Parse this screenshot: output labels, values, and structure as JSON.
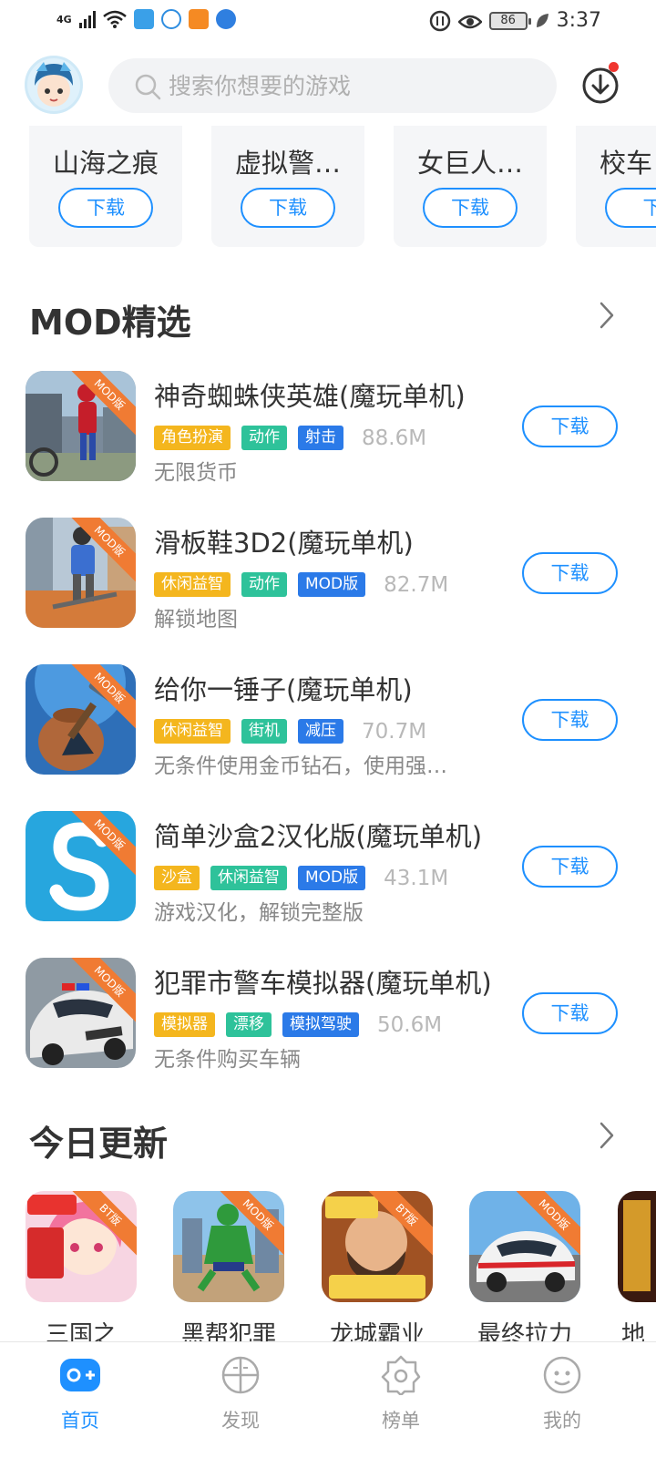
{
  "status_bar": {
    "network": "4G",
    "battery": "86",
    "time": "3:37"
  },
  "search": {
    "placeholder": "搜索你想要的游戏"
  },
  "top_cards": [
    {
      "name": "山海之痕",
      "button": "下载"
    },
    {
      "name": "虚拟警…",
      "button": "下载"
    },
    {
      "name": "女巨人…",
      "button": "下载"
    },
    {
      "name": "校车",
      "button": "下"
    }
  ],
  "mod_section": {
    "title": "MOD精选",
    "items": [
      {
        "name": "神奇蜘蛛侠英雄(魔玩单机)",
        "tags": [
          "角色扮演",
          "动作",
          "射击"
        ],
        "size": "88.6M",
        "desc": "无限货币",
        "badge": "MOD版",
        "button": "下载"
      },
      {
        "name": "滑板鞋3D2(魔玩单机)",
        "tags": [
          "休闲益智",
          "动作",
          "MOD版"
        ],
        "size": "82.7M",
        "desc": "解锁地图",
        "badge": "MOD版",
        "button": "下载"
      },
      {
        "name": "给你一锤子(魔玩单机)",
        "tags": [
          "休闲益智",
          "街机",
          "减压"
        ],
        "size": "70.7M",
        "desc": "无条件使用金币钻石，使用强…",
        "badge": "MOD版",
        "button": "下载"
      },
      {
        "name": "简单沙盒2汉化版(魔玩单机)",
        "tags": [
          "沙盒",
          "休闲益智",
          "MOD版"
        ],
        "size": "43.1M",
        "desc": "游戏汉化，解锁完整版",
        "badge": "MOD版",
        "button": "下载"
      },
      {
        "name": "犯罪市警车模拟器(魔玩单机)",
        "tags": [
          "模拟器",
          "漂移",
          "模拟驾驶"
        ],
        "size": "50.6M",
        "desc": "无条件购买车辆",
        "badge": "MOD版",
        "button": "下载"
      }
    ]
  },
  "today_section": {
    "title": "今日更新",
    "items": [
      {
        "name": "三国之",
        "badge": "BT版"
      },
      {
        "name": "黑帮犯罪",
        "badge": "MOD版"
      },
      {
        "name": "龙城霸业",
        "badge": "BT版"
      },
      {
        "name": "最终拉力",
        "badge": "MOD版"
      },
      {
        "name": "地",
        "badge": ""
      }
    ]
  },
  "bottom_nav": [
    {
      "label": "首页",
      "icon": "home-gamepad-icon",
      "active": true
    },
    {
      "label": "发现",
      "icon": "discover-icon",
      "active": false
    },
    {
      "label": "榜单",
      "icon": "ranking-icon",
      "active": false
    },
    {
      "label": "我的",
      "icon": "profile-icon",
      "active": false
    }
  ],
  "colors": {
    "accent": "#1e90ff",
    "tag_yellow": "#f4b61e",
    "tag_green": "#2ec29a",
    "tag_blue": "#2b7ae8",
    "badge_orange": "#f07b33"
  }
}
